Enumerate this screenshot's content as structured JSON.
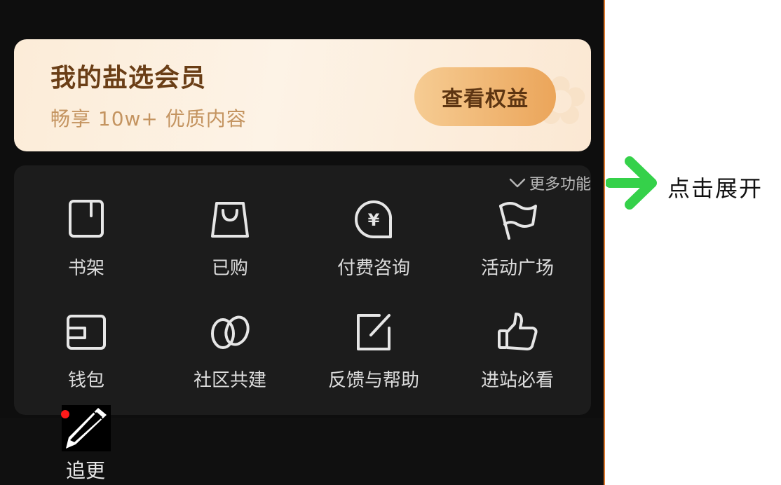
{
  "member": {
    "title": "我的盐选会员",
    "subtitle": "畅享 10w+ 优质内容",
    "button": "查看权益"
  },
  "panel": {
    "more_label": "更多功能",
    "items": [
      {
        "label": "书架",
        "icon": "bookshelf-icon"
      },
      {
        "label": "已购",
        "icon": "shopping-bag-icon"
      },
      {
        "label": "付费咨询",
        "icon": "paid-consult-icon"
      },
      {
        "label": "活动广场",
        "icon": "flag-icon"
      },
      {
        "label": "钱包",
        "icon": "wallet-icon"
      },
      {
        "label": "社区共建",
        "icon": "community-icon"
      },
      {
        "label": "反馈与帮助",
        "icon": "feedback-icon"
      },
      {
        "label": "进站必看",
        "icon": "thumbs-up-icon"
      }
    ]
  },
  "bottom": {
    "update_label": "追更",
    "update_icon": "pencil-icon"
  },
  "annotation": {
    "text": "点击展开",
    "arrow_color": "#35d14a"
  }
}
